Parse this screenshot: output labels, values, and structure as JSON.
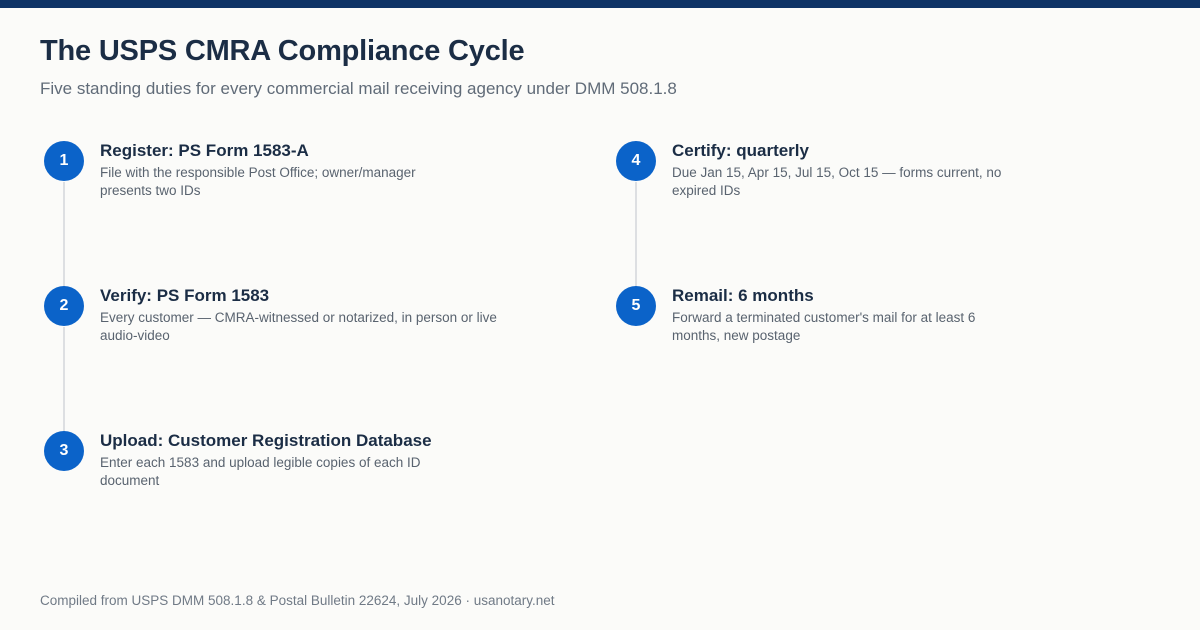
{
  "header": {
    "title": "The USPS CMRA Compliance Cycle",
    "subtitle": "Five standing duties for every commercial mail receiving agency under DMM 508.1.8"
  },
  "steps": [
    {
      "number": "1",
      "title": "Register: PS Form 1583-A",
      "description": "File with the responsible Post Office; owner/manager presents two IDs"
    },
    {
      "number": "2",
      "title": "Verify: PS Form 1583",
      "description": "Every customer — CMRA-witnessed or notarized, in person or live audio-video"
    },
    {
      "number": "3",
      "title": "Upload: Customer Registration Database",
      "description": "Enter each 1583 and upload legible copies of each ID document"
    },
    {
      "number": "4",
      "title": "Certify: quarterly",
      "description": "Due Jan 15, Apr 15, Jul 15, Oct 15 — forms current, no expired IDs"
    },
    {
      "number": "5",
      "title": "Remail: 6 months",
      "description": "Forward a terminated customer's mail for at least 6 months, new postage"
    }
  ],
  "footer": {
    "source": "Compiled from USPS DMM 508.1.8 & Postal Bulletin 22624, July 2026 · usanotary.net"
  },
  "colors": {
    "accent": "#0b63c9",
    "top_bar": "#0e3366",
    "title": "#1b2d45"
  }
}
